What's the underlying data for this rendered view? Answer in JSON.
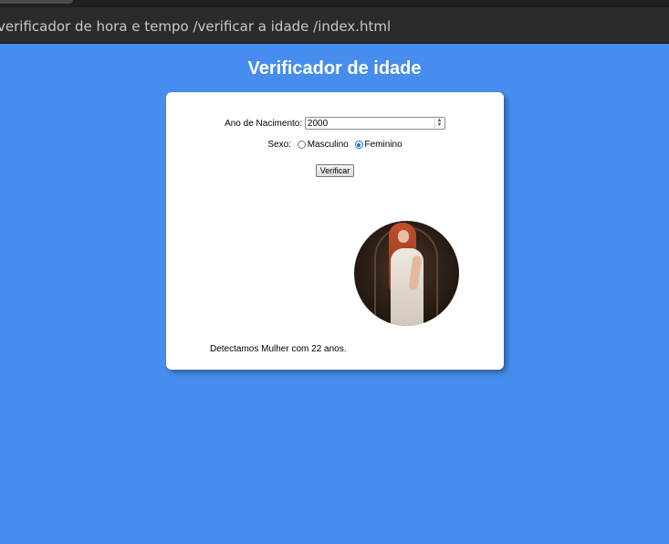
{
  "browser": {
    "url_text": "verificador de hora e tempo /verificar a idade /index.html"
  },
  "page": {
    "title": "Verificador de idade"
  },
  "form": {
    "year_label": "Ano de Nacimento:",
    "year_value": "2000",
    "sex_label": "Sexo:",
    "sex_options": [
      "Masculino",
      "Feminino"
    ],
    "sex_selected": "Feminino",
    "submit_label": "Verificar"
  },
  "result": {
    "text": "Detectamos Mulher com 22 anos."
  },
  "colors": {
    "background": "#468ded",
    "card": "#ffffff",
    "radio_accent": "#1a6fd8"
  }
}
